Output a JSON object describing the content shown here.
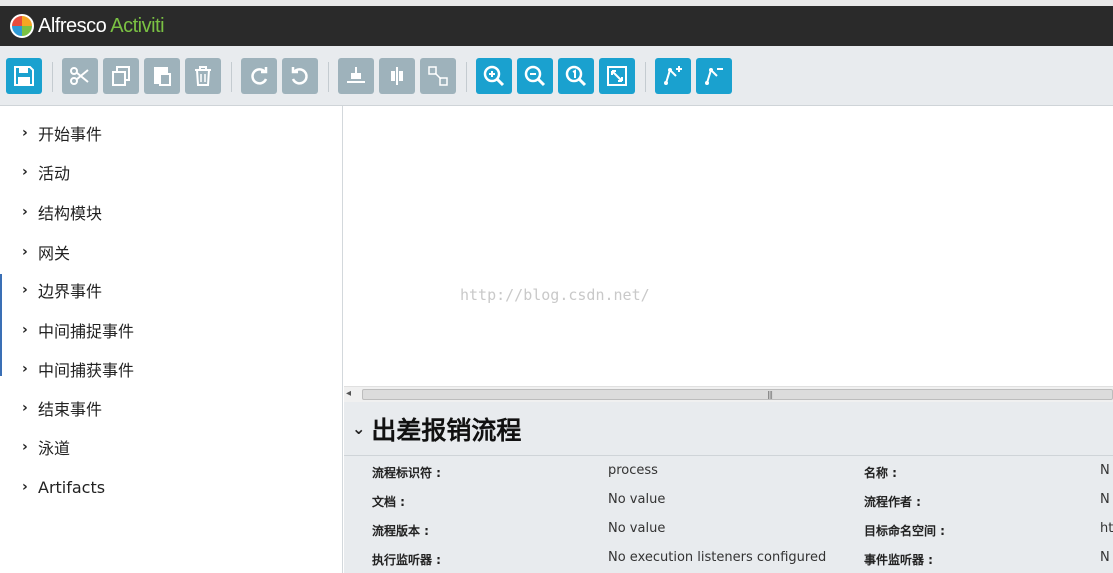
{
  "app": {
    "brand": "Alfresco",
    "product": "Activiti"
  },
  "toolbar": {
    "buttons": [
      {
        "name": "save",
        "color": "#1aa1cf"
      },
      {
        "name": "cut",
        "color": "#9eb2bb"
      },
      {
        "name": "copy",
        "color": "#9eb2bb"
      },
      {
        "name": "paste",
        "color": "#9eb2bb"
      },
      {
        "name": "delete",
        "color": "#9eb2bb"
      },
      {
        "name": "redo",
        "color": "#9eb2bb"
      },
      {
        "name": "undo",
        "color": "#9eb2bb"
      },
      {
        "name": "align-horizontal",
        "color": "#9eb2bb"
      },
      {
        "name": "align-vertical",
        "color": "#9eb2bb"
      },
      {
        "name": "same-size",
        "color": "#9eb2bb"
      },
      {
        "name": "zoom-in",
        "color": "#1aa1cf"
      },
      {
        "name": "zoom-out",
        "color": "#1aa1cf"
      },
      {
        "name": "zoom-actual",
        "color": "#1aa1cf"
      },
      {
        "name": "zoom-fit",
        "color": "#1aa1cf"
      },
      {
        "name": "add-bendpoint",
        "color": "#1aa1cf"
      },
      {
        "name": "remove-bendpoint",
        "color": "#1aa1cf"
      }
    ]
  },
  "palette": {
    "items": [
      {
        "label": "开始事件"
      },
      {
        "label": "活动"
      },
      {
        "label": "结构模块"
      },
      {
        "label": "网关"
      },
      {
        "label": "边界事件"
      },
      {
        "label": "中间捕捉事件"
      },
      {
        "label": "中间捕获事件"
      },
      {
        "label": "结束事件"
      },
      {
        "label": "泳道"
      },
      {
        "label": "Artifacts"
      }
    ]
  },
  "canvas": {
    "watermark": "http://blog.csdn.net/"
  },
  "properties": {
    "title": "出差报销流程",
    "rows": [
      {
        "label": "流程标识符 :",
        "value": "process",
        "label2": "名称 :",
        "value2": "N"
      },
      {
        "label": "文档 :",
        "value": "No value",
        "label2": "流程作者 :",
        "value2": "N"
      },
      {
        "label": "流程版本 :",
        "value": "No value",
        "label2": "目标命名空间 :",
        "value2": "ht"
      },
      {
        "label": "执行监听器 :",
        "value": "No execution listeners configured",
        "label2": "事件监听器 :",
        "value2": "N"
      }
    ]
  }
}
